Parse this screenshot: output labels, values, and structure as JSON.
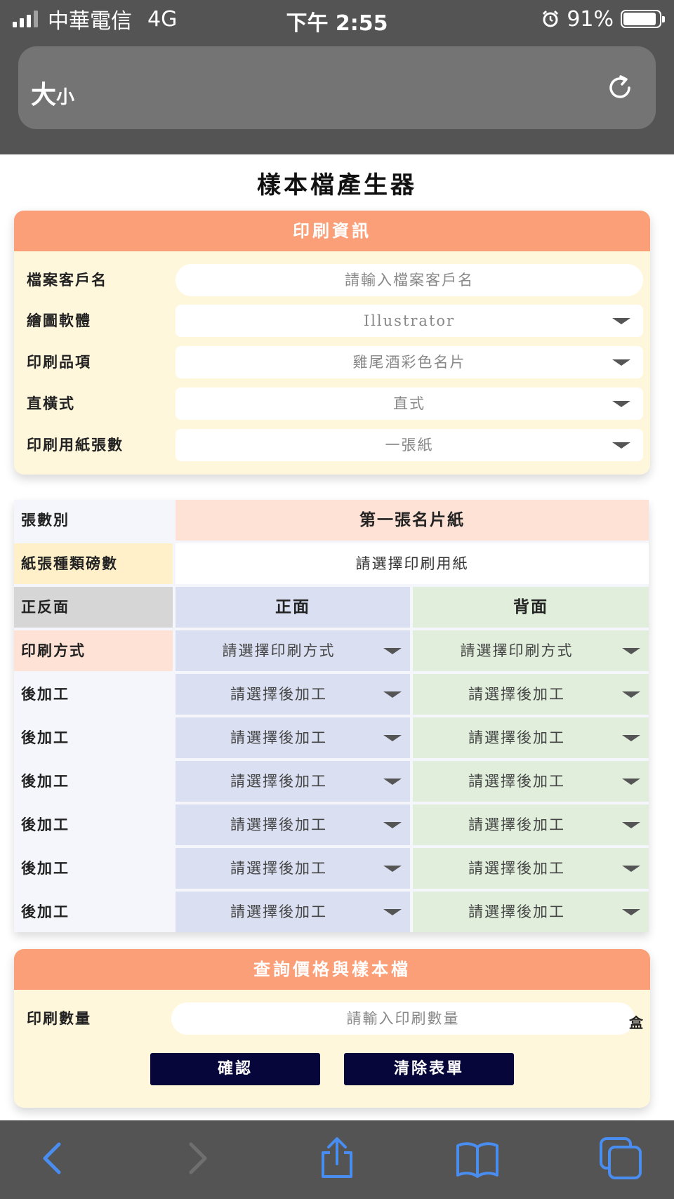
{
  "status_bar": {
    "carrier": "中華電信",
    "network": "4G",
    "time": "下午 2:55",
    "battery": "91%",
    "battery_level": 0.91
  },
  "url_bar": {
    "text_size_big": "大",
    "text_size_small": "小"
  },
  "page": {
    "title": "樣本檔產生器"
  },
  "print_info": {
    "header": "印刷資訊",
    "fields": [
      {
        "label": "檔案客戶名",
        "placeholder": "請輸入檔案客戶名"
      },
      {
        "label": "繪圖軟體",
        "value": "Illustrator"
      },
      {
        "label": "印刷品項",
        "value": "雞尾酒彩色名片"
      },
      {
        "label": "直橫式",
        "value": "直式"
      },
      {
        "label": "印刷用紙張數",
        "value": "一張紙"
      }
    ]
  },
  "paper_table": {
    "sheet_label": "張數別",
    "sheet_value": "第一張名片紙",
    "paper_label": "紙張種類磅數",
    "paper_value": "請選擇印刷用紙",
    "side_label": "正反面",
    "front": "正面",
    "back": "背面",
    "print_method_label": "印刷方式",
    "print_method_placeholder": "請選擇印刷方式",
    "post_label": "後加工",
    "post_placeholder": "請選擇後加工"
  },
  "query": {
    "header": "查詢價格與樣本檔",
    "quantity_label": "印刷數量",
    "quantity_placeholder": "請輸入印刷數量",
    "unit": "盒",
    "confirm": "確認",
    "clear": "清除表單"
  },
  "colors": {
    "header_orange": "#fb9f78",
    "card_cream": "#fff7dc",
    "front_blue": "#dae0f2",
    "back_green": "#e0eedb",
    "button_navy": "#06063a",
    "safari_icon_blue": "#3b82f6"
  },
  "toolbar_icons": [
    "back-arrow-icon",
    "forward-arrow-icon",
    "share-icon",
    "bookmarks-icon",
    "tabs-icon"
  ]
}
